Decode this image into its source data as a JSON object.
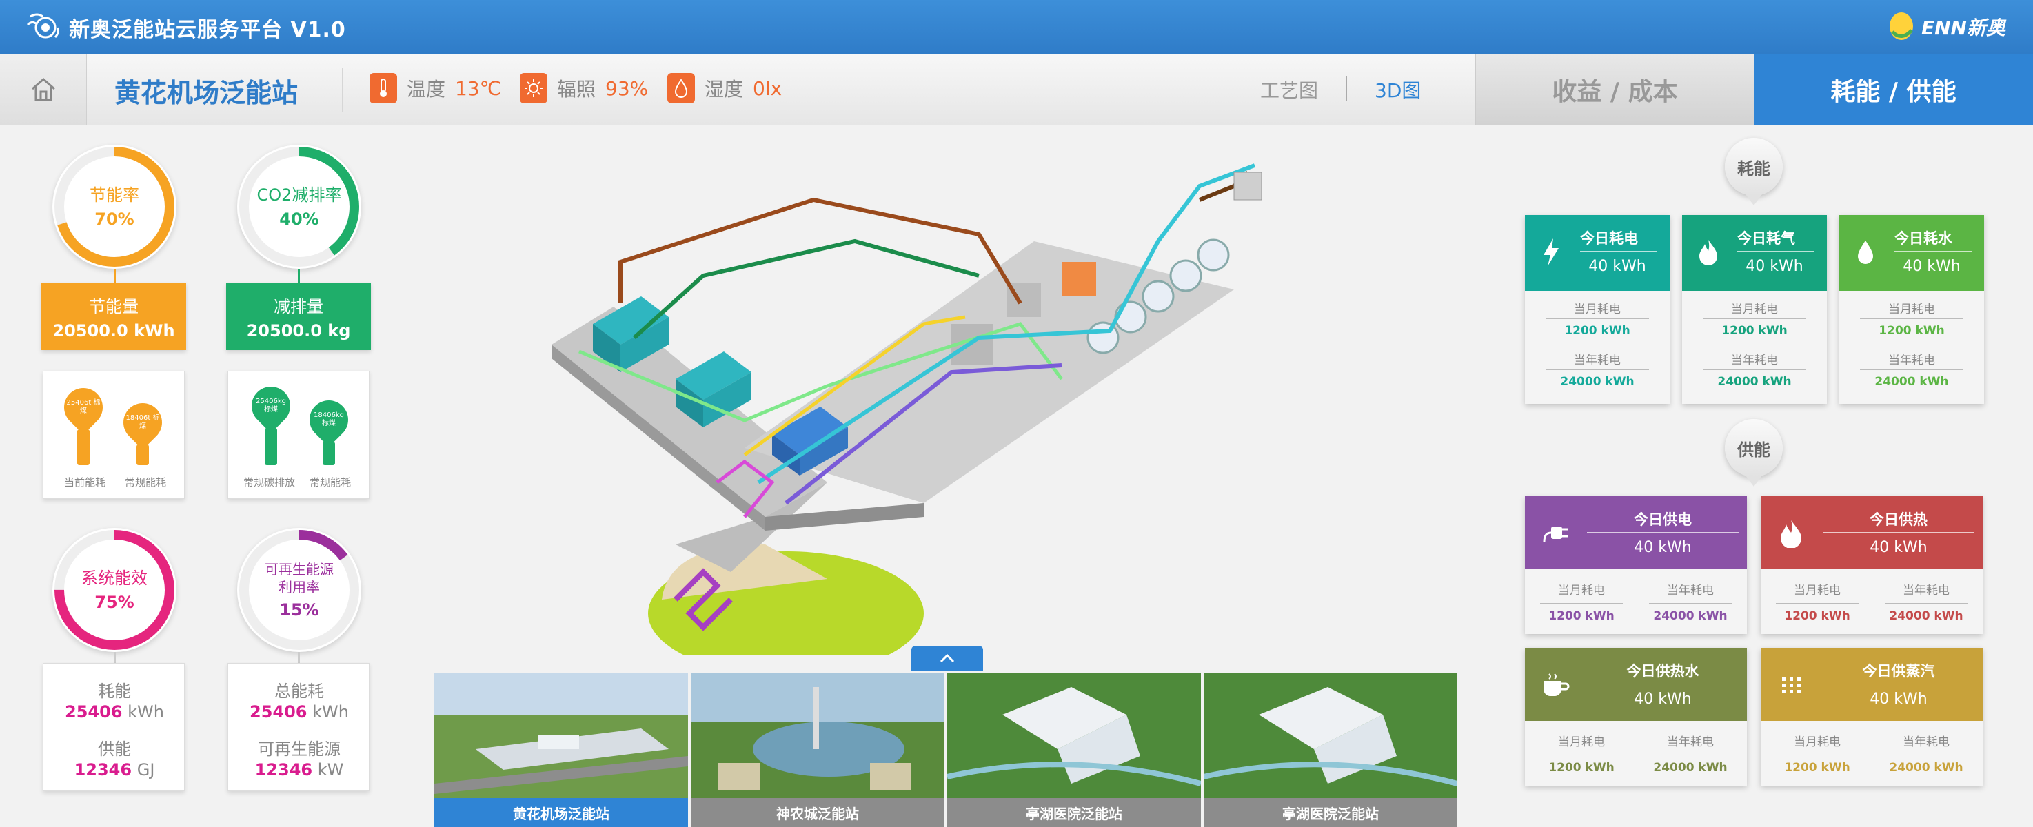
{
  "app": {
    "title": "新奥泛能站云服务平台 V1.0",
    "brand": "ENN新奥"
  },
  "header": {
    "station_name": "黄花机场泛能站",
    "weather": [
      {
        "label": "温度",
        "value": "13℃",
        "icon": "thermometer-icon"
      },
      {
        "label": "辐照",
        "value": "93%",
        "icon": "sun-icon"
      },
      {
        "label": "湿度",
        "value": "0lx",
        "icon": "droplet-icon"
      }
    ],
    "view_tabs": [
      {
        "label": "工艺图"
      },
      {
        "label": "3D图"
      }
    ],
    "main_tabs": [
      {
        "label": "收益 / 成本"
      },
      {
        "label": "耗能 / 供能"
      }
    ],
    "colors": {
      "primary": "#2f84d5",
      "weather_accent": "#f06a30"
    }
  },
  "left": {
    "saving": {
      "ring_label": "节能率",
      "ring_value": "70%",
      "ring_level": 0.7,
      "color": "#f6a323",
      "box_title": "节能量",
      "box_value": "20500.0 kWh",
      "pins": [
        {
          "text": "25406t 标煤",
          "caption": "当前能耗"
        },
        {
          "text": "18406t 标煤",
          "caption": "常规能耗"
        }
      ]
    },
    "co2": {
      "ring_label": "CO2减排率",
      "ring_value": "40%",
      "ring_level": 0.4,
      "color": "#1fae6a",
      "box_title": "减排量",
      "box_value": "20500.0 kg",
      "pins": [
        {
          "text": "25406kg 标煤",
          "caption": "常规碳排放"
        },
        {
          "text": "18406kg 标煤",
          "caption": "常规能耗"
        }
      ]
    },
    "efficiency": {
      "ring_label": "系统能效",
      "ring_value": "75%",
      "ring_level": 0.75,
      "color": "#e5257e",
      "rows": [
        {
          "label": "耗能",
          "value": "25406",
          "unit": "kWh"
        },
        {
          "label": "供能",
          "value": "12346",
          "unit": "GJ"
        }
      ]
    },
    "renewable": {
      "ring_label_1": "可再生能源",
      "ring_label_2": "利用率",
      "ring_value": "15%",
      "ring_level": 0.15,
      "color": "#9b2f9c",
      "rows": [
        {
          "label": "总能耗",
          "value": "25406",
          "unit": "kWh"
        },
        {
          "label": "可再生能源",
          "value": "12346",
          "unit": "kW"
        }
      ]
    }
  },
  "stations": [
    {
      "name": "黄花机场泛能站"
    },
    {
      "name": "神农城泛能站"
    },
    {
      "name": "亭湖医院泛能站"
    },
    {
      "name": "亭湖医院泛能站"
    }
  ],
  "right": {
    "consumption": {
      "badge": "耗能",
      "cards": [
        {
          "title": "今日耗电",
          "value": "40 kWh",
          "month_label": "当月耗电",
          "month_value": "1200 kWh",
          "year_label": "当年耗电",
          "year_value": "24000 kWh",
          "color": "#14a99a",
          "icon": "lightning-icon"
        },
        {
          "title": "今日耗气",
          "value": "40 kWh",
          "month_label": "当月耗电",
          "month_value": "1200 kWh",
          "year_label": "当年耗电",
          "year_value": "24000 kWh",
          "color": "#16a37e",
          "icon": "flame-icon"
        },
        {
          "title": "今日耗水",
          "value": "40 kWh",
          "month_label": "当月耗电",
          "month_value": "1200 kWh",
          "year_label": "当年耗电",
          "year_value": "24000 kWh",
          "color": "#5bb544",
          "icon": "water-drop-icon"
        }
      ]
    },
    "supply": {
      "badge": "供能",
      "cards": [
        {
          "title": "今日供电",
          "value": "40 kWh",
          "month_label": "当月耗电",
          "month_value": "1200 kWh",
          "year_label": "当年耗电",
          "year_value": "24000 kWh",
          "color": "#8a52a6",
          "icon": "plug-icon"
        },
        {
          "title": "今日供热",
          "value": "40 kWh",
          "month_label": "当月耗电",
          "month_value": "1200 kWh",
          "year_label": "当年耗电",
          "year_value": "24000 kWh",
          "color": "#c44a4a",
          "icon": "fire-icon"
        },
        {
          "title": "今日供热水",
          "value": "40 kWh",
          "month_label": "当月耗电",
          "month_value": "1200 kWh",
          "year_label": "当年耗电",
          "year_value": "24000 kWh",
          "color": "#7b8b45",
          "icon": "coffee-cup-icon"
        },
        {
          "title": "今日供蒸汽",
          "value": "40 kWh",
          "month_label": "当月耗电",
          "month_value": "1200 kWh",
          "year_label": "当年耗电",
          "year_value": "24000 kWh",
          "color": "#c8a23a",
          "icon": "steam-dots-icon"
        }
      ]
    }
  }
}
